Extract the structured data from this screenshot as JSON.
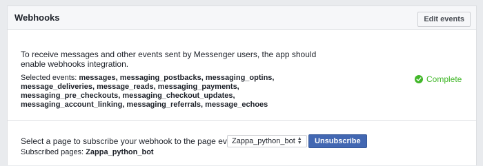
{
  "panel": {
    "title": "Webhooks",
    "edit_button_label": "Edit events"
  },
  "events_section": {
    "intro": "To receive messages and other events sent by Messenger users, the app should enable webhooks integration.",
    "selected_label": "Selected events:",
    "selected_events": "messages, messaging_postbacks, messaging_optins, message_deliveries, message_reads, messaging_payments, messaging_pre_checkouts, messaging_checkout_updates, messaging_account_linking, messaging_referrals, message_echoes",
    "status_text": "Complete",
    "status_color": "#42b72a",
    "status_icon": "check-circle-icon"
  },
  "subscription_section": {
    "prompt": "Select a page to subscribe your webhook to the page events",
    "selected_page": "Zappa_python_bot",
    "unsubscribe_label": "Unsubscribe",
    "subscribed_label": "Subscribed pages:",
    "subscribed_page": "Zappa_python_bot"
  }
}
